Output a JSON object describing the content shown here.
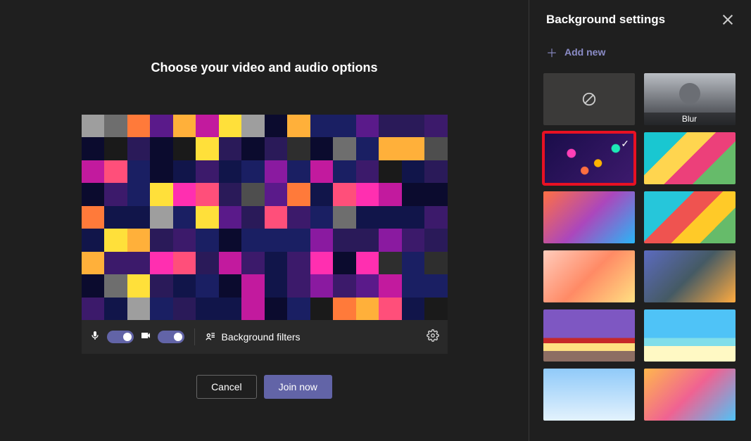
{
  "main": {
    "title": "Choose your video and audio options",
    "controls": {
      "mic_on": true,
      "cam_on": true,
      "bg_filters_label": "Background filters"
    },
    "buttons": {
      "cancel": "Cancel",
      "join": "Join now"
    }
  },
  "panel": {
    "title": "Background settings",
    "add_new_label": "Add new",
    "tiles": {
      "none_label": "None",
      "blur_label": "Blur"
    },
    "selected_index": 2,
    "highlighted_index": 2,
    "options": [
      {
        "id": "none",
        "kind": "none"
      },
      {
        "id": "blur",
        "kind": "blur"
      },
      {
        "id": "lights",
        "kind": "image"
      },
      {
        "id": "tropical",
        "kind": "image"
      },
      {
        "id": "hands",
        "kind": "image"
      },
      {
        "id": "vote",
        "kind": "image"
      },
      {
        "id": "cake",
        "kind": "image"
      },
      {
        "id": "living",
        "kind": "image"
      },
      {
        "id": "shelf",
        "kind": "image"
      },
      {
        "id": "beach",
        "kind": "image"
      },
      {
        "id": "sky",
        "kind": "image"
      },
      {
        "id": "sunset",
        "kind": "image"
      }
    ]
  },
  "preview_pixels_palette": [
    "#0b0b2e",
    "#11154a",
    "#1a1f63",
    "#2a1a59",
    "#3c1a6b",
    "#5a1a8a",
    "#8a1aa0",
    "#c21a9e",
    "#ff2fb0",
    "#ff4f7a",
    "#ff7a3a",
    "#ffb03a",
    "#ffe03a",
    "#c8ff5a",
    "#7aff9a",
    "#3affc8",
    "#3ac8ff",
    "#3a7aff",
    "#5a3aff",
    "#1a1a1a",
    "#2e2e2e",
    "#4e4e4e",
    "#6e6e6e",
    "#9e9e9e"
  ]
}
